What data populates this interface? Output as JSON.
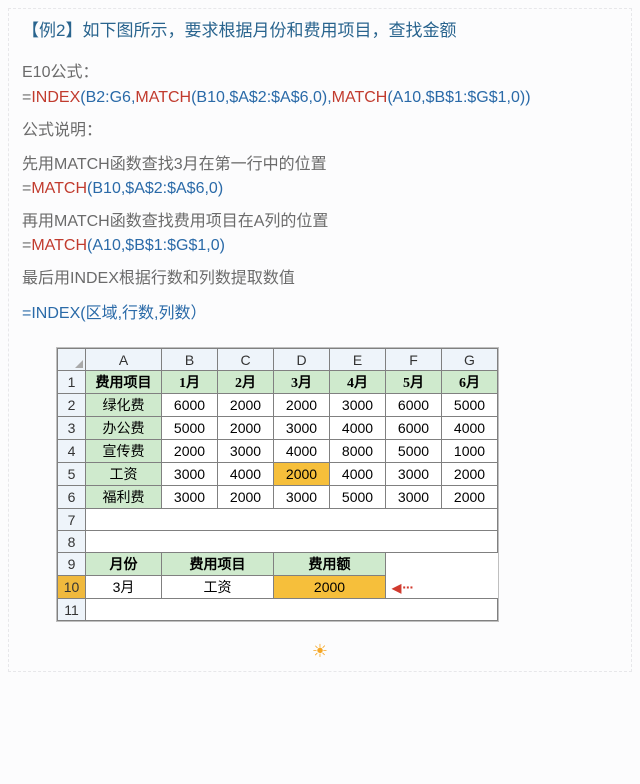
{
  "title": "【例2】如下图所示，要求根据月份和费用项目，查找金额",
  "hdr1": "E10公式：",
  "f1": {
    "eq": "=",
    "fn1": "INDEX",
    "a1": "(B2:G6,",
    "fn2": "MATCH",
    "a2": "(B10,$A$2:$A$6,0),",
    "fn3": "MATCH",
    "a3": "(A10,$B$1:$G$1,0))"
  },
  "desc1a": "公式说明：",
  "desc1b": "先用MATCH函数查找3月在第一行中的位置",
  "f2": {
    "eq": "=",
    "fn": "MATCH",
    "arg": "(B10,$A$2:$A$6,0)"
  },
  "desc2": "再用MATCH函数查找费用项目在A列的位置",
  "f3": {
    "eq": "=",
    "fn": "MATCH",
    "arg": "(A10,$B$1:$G$1,0)"
  },
  "desc3": "最后用INDEX根据行数和列数提取数值",
  "f4": "=INDEX(区域,行数,列数）",
  "chart_data": {
    "type": "table",
    "columns": [
      "",
      "A",
      "B",
      "C",
      "D",
      "E",
      "F",
      "G"
    ],
    "header_row": [
      "费用项目",
      "1月",
      "2月",
      "3月",
      "4月",
      "5月",
      "6月"
    ],
    "rows": [
      {
        "r": "2",
        "label": "绿化费",
        "vals": [
          6000,
          2000,
          2000,
          3000,
          6000,
          5000
        ]
      },
      {
        "r": "3",
        "label": "办公费",
        "vals": [
          5000,
          2000,
          3000,
          4000,
          6000,
          4000
        ]
      },
      {
        "r": "4",
        "label": "宣传费",
        "vals": [
          2000,
          3000,
          4000,
          8000,
          5000,
          1000
        ]
      },
      {
        "r": "5",
        "label": "工资",
        "vals": [
          3000,
          4000,
          2000,
          4000,
          3000,
          2000
        ]
      },
      {
        "r": "6",
        "label": "福利费",
        "vals": [
          3000,
          2000,
          3000,
          5000,
          3000,
          2000
        ]
      }
    ],
    "highlight": {
      "row": 5,
      "col": "D",
      "value": 2000
    },
    "lookup_header": {
      "r": "9",
      "a": "月份",
      "b_c": "费用项目",
      "d_e": "费用额"
    },
    "lookup_row": {
      "r": "10",
      "a": "3月",
      "b_c": "工资",
      "d_e": 2000
    },
    "trailing_rows": [
      "7",
      "8",
      "11"
    ]
  },
  "arrow": "···",
  "sun": "☀"
}
